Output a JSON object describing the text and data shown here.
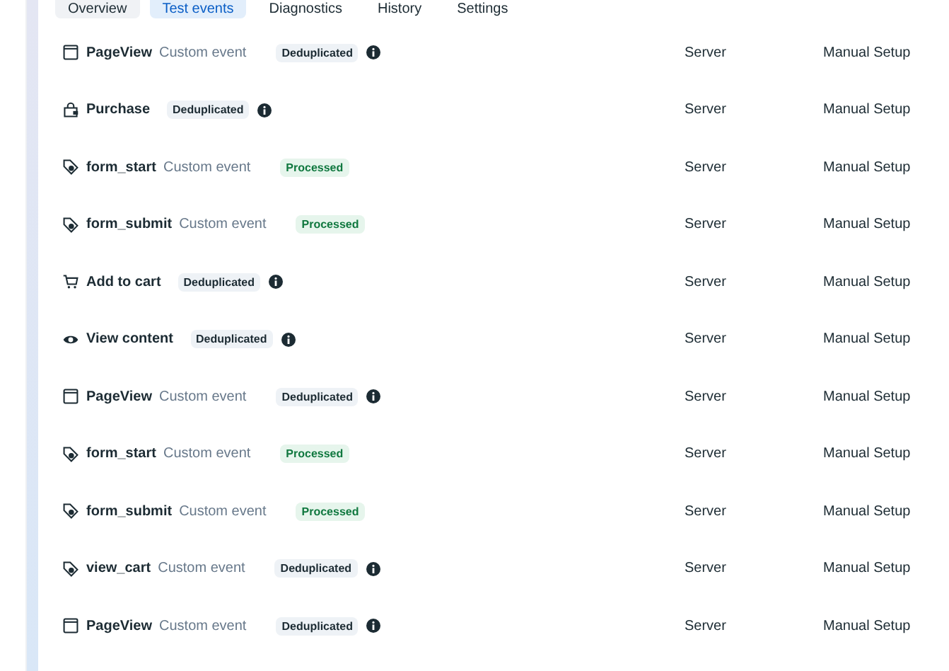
{
  "tabs": [
    {
      "label": "Overview",
      "selected": false,
      "hovered": true
    },
    {
      "label": "Test events",
      "selected": true,
      "hovered": false
    },
    {
      "label": "Diagnostics",
      "selected": false,
      "hovered": false
    },
    {
      "label": "History",
      "selected": false,
      "hovered": false
    },
    {
      "label": "Settings",
      "selected": false,
      "hovered": false
    }
  ],
  "events": [
    {
      "kind": "page",
      "name": "PageView",
      "type": "Custom event",
      "status": {
        "label": "Deduplicated",
        "kind": "deduplicated"
      },
      "source": "Server",
      "setup": "Manual Setup"
    },
    {
      "kind": "bag",
      "name": "Purchase",
      "status": {
        "label": "Deduplicated",
        "kind": "deduplicated"
      },
      "source": "Server",
      "setup": "Manual Setup"
    },
    {
      "kind": "tag",
      "name": "form_start",
      "type": "Custom event",
      "status": {
        "label": "Processed",
        "kind": "processed"
      },
      "source": "Server",
      "setup": "Manual Setup"
    },
    {
      "kind": "tag",
      "name": "form_submit",
      "type": "Custom event",
      "status": {
        "label": "Processed",
        "kind": "processed"
      },
      "source": "Server",
      "setup": "Manual Setup"
    },
    {
      "kind": "cart",
      "name": "Add to cart",
      "status": {
        "label": "Deduplicated",
        "kind": "deduplicated"
      },
      "source": "Server",
      "setup": "Manual Setup"
    },
    {
      "kind": "eye",
      "name": "View content",
      "status": {
        "label": "Deduplicated",
        "kind": "deduplicated"
      },
      "source": "Server",
      "setup": "Manual Setup"
    },
    {
      "kind": "page",
      "name": "PageView",
      "type": "Custom event",
      "status": {
        "label": "Deduplicated",
        "kind": "deduplicated"
      },
      "source": "Server",
      "setup": "Manual Setup"
    },
    {
      "kind": "tag",
      "name": "form_start",
      "type": "Custom event",
      "status": {
        "label": "Processed",
        "kind": "processed"
      },
      "source": "Server",
      "setup": "Manual Setup"
    },
    {
      "kind": "tag",
      "name": "form_submit",
      "type": "Custom event",
      "status": {
        "label": "Processed",
        "kind": "processed"
      },
      "source": "Server",
      "setup": "Manual Setup"
    },
    {
      "kind": "tag",
      "name": "view_cart",
      "type": "Custom event",
      "status": {
        "label": "Deduplicated",
        "kind": "deduplicated"
      },
      "source": "Server",
      "setup": "Manual Setup"
    },
    {
      "kind": "page",
      "name": "PageView",
      "type": "Custom event",
      "status": {
        "label": "Deduplicated",
        "kind": "deduplicated"
      },
      "source": "Server",
      "setup": "Manual Setup"
    }
  ]
}
